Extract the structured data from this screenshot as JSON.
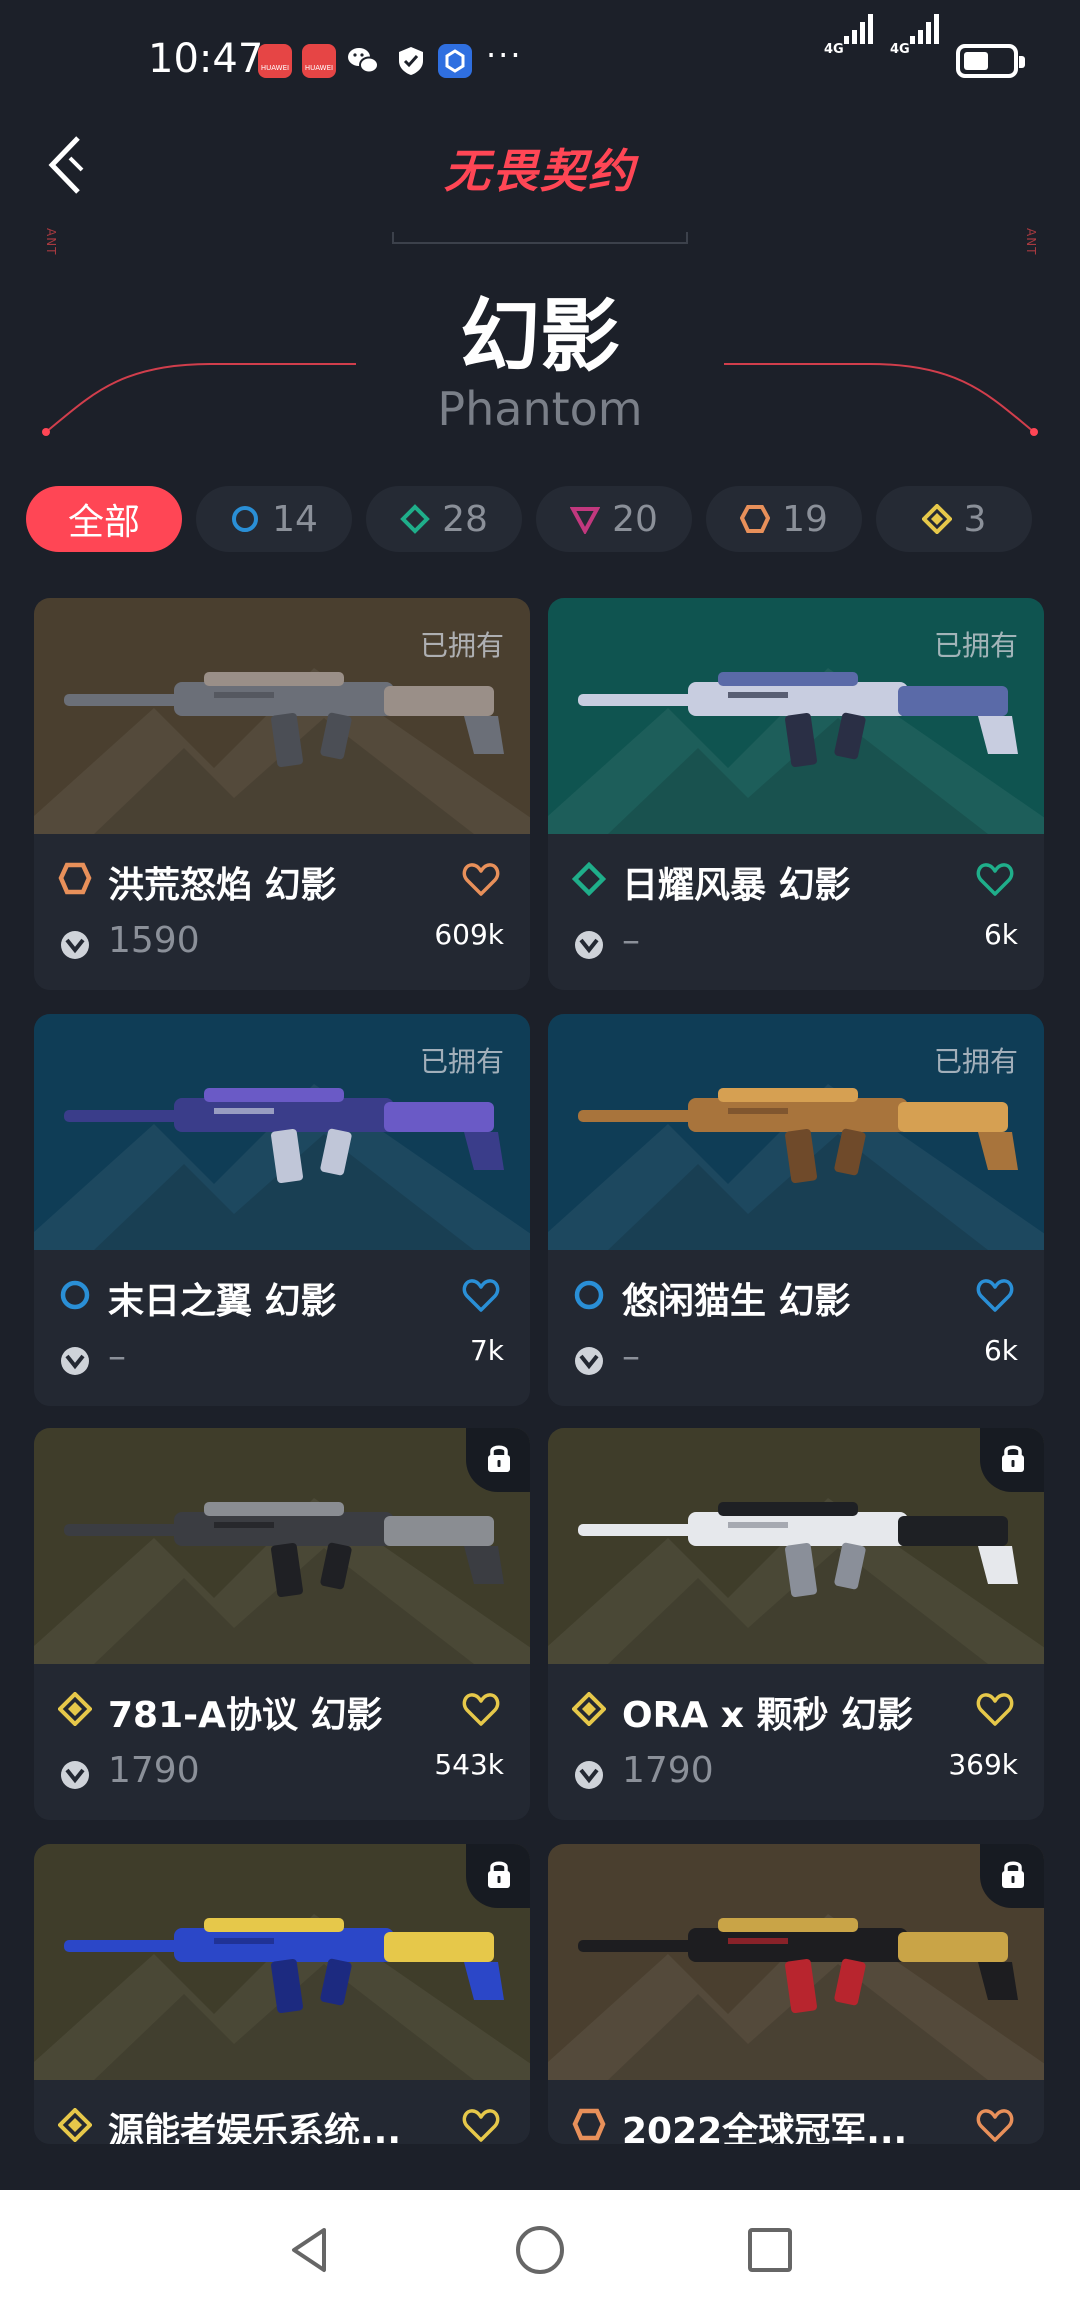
{
  "status_bar": {
    "time": "10:47",
    "notif_brand": "HUAWEI",
    "more": "···",
    "network_1": "4G",
    "network_2": "4G"
  },
  "header": {
    "brand": "无畏契约",
    "side_tag": "ANT",
    "title": "幻影",
    "subtitle": "Phantom"
  },
  "filters": [
    {
      "label": "全部",
      "icon": "all",
      "active": true
    },
    {
      "label": "14",
      "icon": "select-tier-icon",
      "color": "#2a8fd6"
    },
    {
      "label": "28",
      "icon": "deluxe-tier-icon",
      "color": "#1fae8a"
    },
    {
      "label": "20",
      "icon": "premium-tier-icon",
      "color": "#c2387e"
    },
    {
      "label": "19",
      "icon": "exclusive-tier-icon",
      "color": "#e8905a"
    },
    {
      "label": "3",
      "icon": "ultra-tier-icon",
      "color": "#e6c84a"
    }
  ],
  "cards": [
    {
      "name": "洪荒怒焰 幻影",
      "price": "1590",
      "count": "609k",
      "status": "已拥有",
      "tier_color": "#e8905a",
      "tier": "exclusive",
      "bg": "#4a3f2f"
    },
    {
      "name": "日耀风暴 幻影",
      "price": "–",
      "count": "6k",
      "status": "已拥有",
      "tier_color": "#1fae8a",
      "tier": "deluxe",
      "bg": "#0f5450"
    },
    {
      "name": "末日之翼 幻影",
      "price": "–",
      "count": "7k",
      "status": "已拥有",
      "tier_color": "#2a8fd6",
      "tier": "select",
      "bg": "#0f3d56"
    },
    {
      "name": "悠闲猫生 幻影",
      "price": "–",
      "count": "6k",
      "status": "已拥有",
      "tier_color": "#2a8fd6",
      "tier": "select",
      "bg": "#0f3d56"
    },
    {
      "name": "781-A协议 幻影",
      "price": "1790",
      "count": "543k",
      "status": "locked",
      "tier_color": "#e6c84a",
      "tier": "ultra",
      "bg": "#3f3d2a"
    },
    {
      "name": "ORA x 颗秒 幻影",
      "price": "1790",
      "count": "369k",
      "status": "locked",
      "tier_color": "#e6c84a",
      "tier": "ultra",
      "bg": "#3f3d2a"
    },
    {
      "name": "源能者娱乐系统...",
      "price": "",
      "count": "",
      "status": "locked",
      "tier_color": "#e6c84a",
      "tier": "ultra",
      "bg": "#3f3d2a"
    },
    {
      "name": "2022全球冠军...",
      "price": "",
      "count": "",
      "status": "locked",
      "tier_color": "#e8905a",
      "tier": "exclusive",
      "bg": "#4a3f2f"
    }
  ]
}
